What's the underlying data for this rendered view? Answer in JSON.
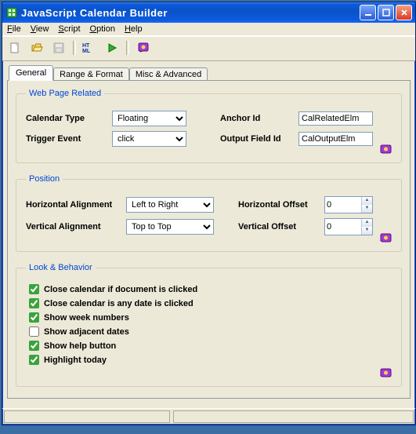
{
  "title": "JavaScript Calendar Builder",
  "menu": {
    "file": "File",
    "view": "View",
    "script": "Script",
    "option": "Option",
    "help": "Help"
  },
  "tabs": {
    "general": "General",
    "range": "Range & Format",
    "misc": "Misc & Advanced"
  },
  "group1": {
    "legend": "Web Page Related",
    "calendar_type_lbl": "Calendar Type",
    "calendar_type_val": "Floating",
    "anchor_id_lbl": "Anchor Id",
    "anchor_id_val": "CalRelatedElm",
    "trigger_event_lbl": "Trigger Event",
    "trigger_event_val": "click",
    "output_field_lbl": "Output Field Id",
    "output_field_val": "CalOutputElm"
  },
  "group2": {
    "legend": "Position",
    "halign_lbl": "Horizontal Alignment",
    "halign_val": "Left to Right",
    "hoffset_lbl": "Horizontal Offset",
    "hoffset_val": "0",
    "valign_lbl": "Vertical Alignment",
    "valign_val": "Top to Top",
    "voffset_lbl": "Vertical Offset",
    "voffset_val": "0"
  },
  "group3": {
    "legend": "Look & Behavior",
    "c1": "Close calendar if document is clicked",
    "c2": "Close calendar is any date is clicked",
    "c3": "Show week numbers",
    "c4": "Show adjacent dates",
    "c5": "Show help button",
    "c6": "Highlight today",
    "checked": {
      "c1": true,
      "c2": true,
      "c3": true,
      "c4": false,
      "c5": true,
      "c6": true
    }
  }
}
